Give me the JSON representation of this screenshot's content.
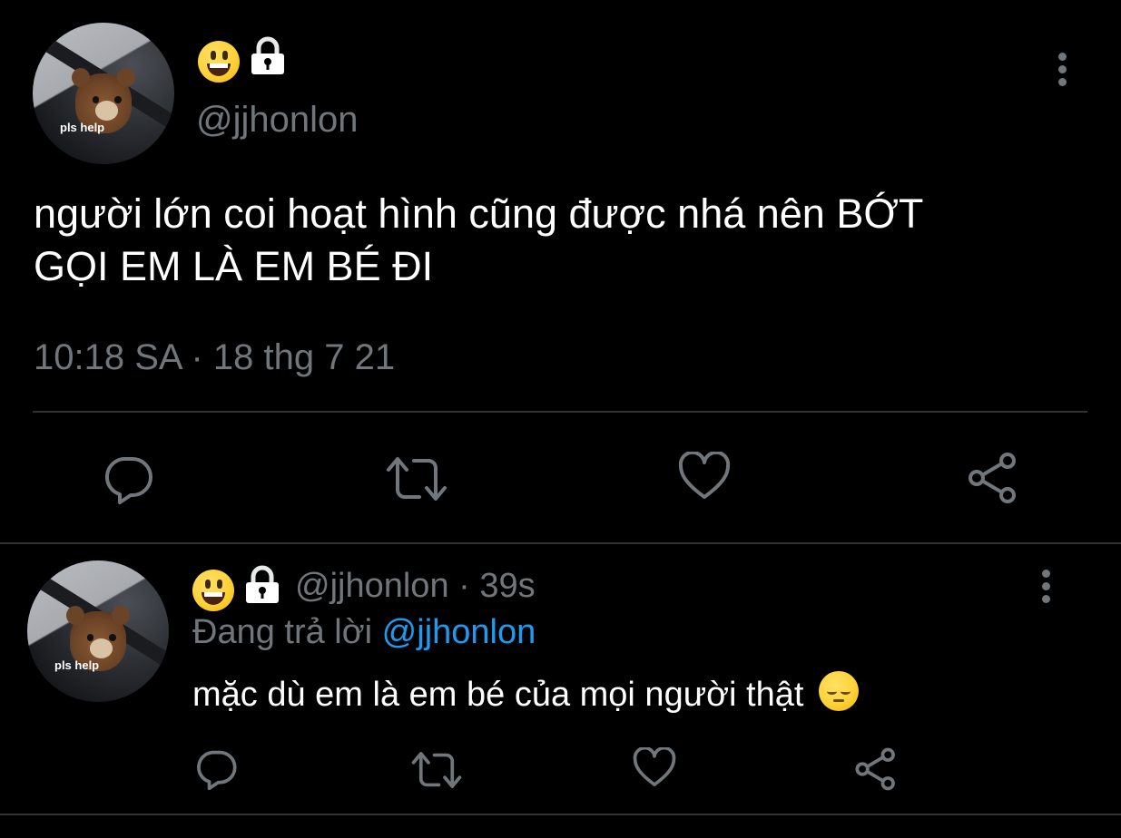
{
  "main_tweet": {
    "avatar_caption": "pls help",
    "display_name_emoji": "grinning-face-emoji",
    "protected_icon": "lock-icon",
    "handle": "@jjhonlon",
    "text_line1": "người lớn coi hoạt hình cũng được nhá nên BỚT",
    "text_line2": "GỌI EM LÀ EM BÉ ĐI",
    "timestamp": "10:18 SA · 18 thg 7 21",
    "actions": [
      "reply-icon",
      "retweet-icon",
      "like-icon",
      "share-icon"
    ]
  },
  "reply": {
    "avatar_caption": "pls help",
    "display_name_emoji": "grinning-face-emoji",
    "protected_icon": "lock-icon",
    "handle_and_time": "@jjhonlon · 39s",
    "replying_prefix": "Đang trả lời ",
    "replying_mention": "@jjhonlon",
    "text": "mặc dù em là em bé của mọi người thật",
    "text_emoji": "pensive-face-emoji",
    "actions": [
      "reply-icon",
      "retweet-icon",
      "like-icon",
      "share-icon"
    ]
  },
  "colors": {
    "background": "#000000",
    "text_primary": "#ffffff",
    "text_secondary": "#71767b",
    "accent": "#1d9bf0",
    "divider": "#2f3336"
  }
}
